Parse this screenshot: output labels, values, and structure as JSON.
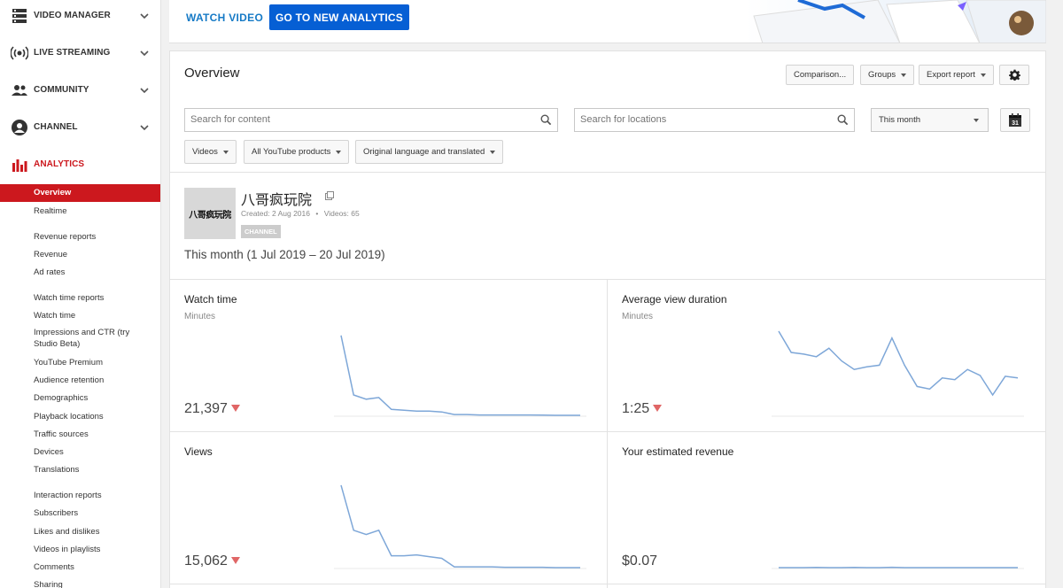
{
  "sidebar": {
    "sections": [
      {
        "label": "VIDEO MANAGER",
        "icon": "video-manager-icon"
      },
      {
        "label": "LIVE STREAMING",
        "icon": "live-streaming-icon"
      },
      {
        "label": "COMMUNITY",
        "icon": "community-icon"
      },
      {
        "label": "CHANNEL",
        "icon": "channel-icon"
      },
      {
        "label": "ANALYTICS",
        "icon": "analytics-icon"
      }
    ],
    "items": [
      "Overview",
      "Realtime",
      "Revenue reports",
      "Revenue",
      "Ad rates",
      "Watch time reports",
      "Watch time",
      "Impressions and CTR (try Studio Beta)",
      "YouTube Premium",
      "Audience retention",
      "Demographics",
      "Playback locations",
      "Traffic sources",
      "Devices",
      "Translations",
      "Interaction reports",
      "Subscribers",
      "Likes and dislikes",
      "Videos in playlists",
      "Comments",
      "Sharing"
    ],
    "active_color": "#cc181e"
  },
  "topbar": {
    "watch_video": "WATCH VIDEO",
    "go_new": "GO TO NEW ANALYTICS"
  },
  "overview": {
    "title": "Overview",
    "buttons": {
      "comparison": "Comparison...",
      "groups": "Groups",
      "export": "Export report"
    },
    "search_content_placeholder": "Search for content",
    "search_locations_placeholder": "Search for locations",
    "date_range": "This month",
    "calendar_day": "31",
    "filters": [
      "Videos",
      "All YouTube products",
      "Original language and translated"
    ]
  },
  "channel": {
    "name": "八哥疯玩院",
    "thumb_text": "八哥疯玩院",
    "created": "Created: 2 Aug 2016",
    "separator": "•",
    "videos": "Videos: 65",
    "badge": "CHANNEL"
  },
  "period": "This month (1 Jul 2019 – 20 Jul 2019)",
  "metrics": [
    {
      "title": "Watch time",
      "unit": "Minutes",
      "value": "21,397",
      "trend": "down",
      "series": [
        95,
        25,
        20,
        22,
        8,
        7,
        6,
        6,
        5,
        2,
        2,
        1.5,
        1.5,
        1.5,
        1.5,
        1.5,
        1.2,
        1,
        1,
        1
      ]
    },
    {
      "title": "Average view duration",
      "unit": "Minutes",
      "value": "1:25",
      "trend": "down",
      "series": [
        100,
        75,
        73,
        70,
        80,
        65,
        55,
        58,
        60,
        92,
        60,
        35,
        32,
        45,
        43,
        55,
        48,
        25,
        47,
        45
      ]
    },
    {
      "title": "Views",
      "unit": "",
      "value": "15,062",
      "trend": "down",
      "series": [
        98,
        45,
        40,
        45,
        15,
        15,
        16,
        14,
        12,
        2,
        2,
        2,
        2,
        1.5,
        1.5,
        1.5,
        1.5,
        1,
        1,
        1
      ]
    },
    {
      "title": "Your estimated revenue",
      "unit": "",
      "value": "$0.07",
      "trend": "",
      "series": [
        1,
        1,
        1,
        1.2,
        1,
        1,
        1.2,
        1,
        1,
        1.5,
        1,
        1,
        1,
        1,
        1,
        1,
        1,
        1,
        1,
        1
      ]
    }
  ],
  "colors": {
    "line": "#7ea7d8",
    "blue_button": "#065fd4",
    "link": "#167ac6",
    "trend_down": "#e06666"
  }
}
